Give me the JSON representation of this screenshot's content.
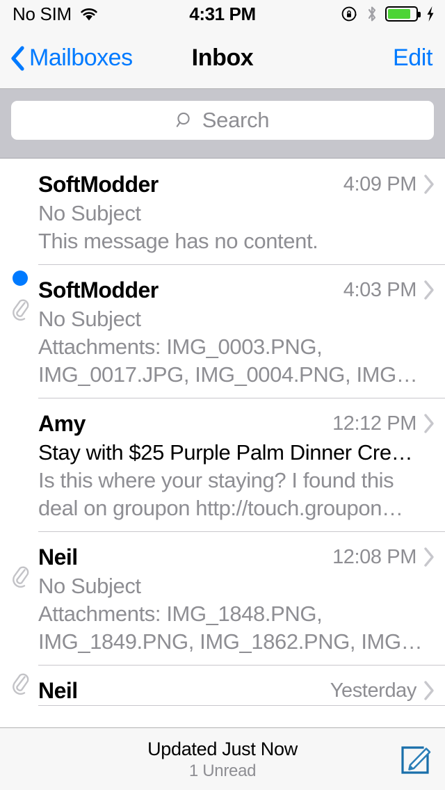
{
  "status_bar": {
    "carrier": "No SIM",
    "wifi_icon": "wifi-icon",
    "time": "4:31 PM",
    "rotation_lock_icon": "rotation-lock-icon",
    "bluetooth_icon": "bluetooth-icon",
    "battery_icon": "battery-icon",
    "battery_level_percent": 82,
    "charging_icon": "lightning-bolt-icon"
  },
  "nav_bar": {
    "back_icon": "chevron-left-icon",
    "back_label": "Mailboxes",
    "title": "Inbox",
    "edit_label": "Edit"
  },
  "search": {
    "icon": "search-icon",
    "placeholder": "Search",
    "value": ""
  },
  "colors": {
    "accent_blue": "#007aff",
    "unread_dot": "#007aff",
    "battery_green": "#4cd435",
    "secondary_text": "#8e8e93",
    "separator": "#c8c7cc",
    "search_bar_bg": "#c6c6cc"
  },
  "messages": [
    {
      "unread": false,
      "has_attachment": false,
      "sender": "SoftModder",
      "time": "4:09 PM",
      "subject": "No Subject",
      "subject_dark": false,
      "preview_lines": [
        "This message has no content."
      ],
      "chevron_icon": "chevron-right-icon"
    },
    {
      "unread": true,
      "has_attachment": true,
      "sender": "SoftModder",
      "time": "4:03 PM",
      "subject": "No Subject",
      "subject_dark": false,
      "preview_lines": [
        "Attachments: IMG_0003.PNG,",
        "IMG_0017.JPG, IMG_0004.PNG, IMG…"
      ],
      "chevron_icon": "chevron-right-icon"
    },
    {
      "unread": false,
      "has_attachment": false,
      "sender": "Amy",
      "time": "12:12 PM",
      "subject": "Stay with $25 Purple Palm Dinner Cre…",
      "subject_dark": true,
      "preview_lines": [
        "Is this where your staying? I found this",
        "deal on groupon http://touch.groupon…"
      ],
      "chevron_icon": "chevron-right-icon"
    },
    {
      "unread": false,
      "has_attachment": true,
      "sender": "Neil",
      "time": "12:08 PM",
      "subject": "No Subject",
      "subject_dark": false,
      "preview_lines": [
        "Attachments: IMG_1848.PNG,",
        "IMG_1849.PNG, IMG_1862.PNG, IMG…"
      ],
      "chevron_icon": "chevron-right-icon"
    },
    {
      "unread": false,
      "has_attachment": true,
      "sender": "Neil",
      "time": "Yesterday",
      "subject": "",
      "subject_dark": false,
      "preview_lines": [],
      "chevron_icon": "chevron-right-icon"
    }
  ],
  "toolbar": {
    "updated_label": "Updated Just Now",
    "unread_label": "1 Unread",
    "compose_icon": "compose-icon"
  }
}
